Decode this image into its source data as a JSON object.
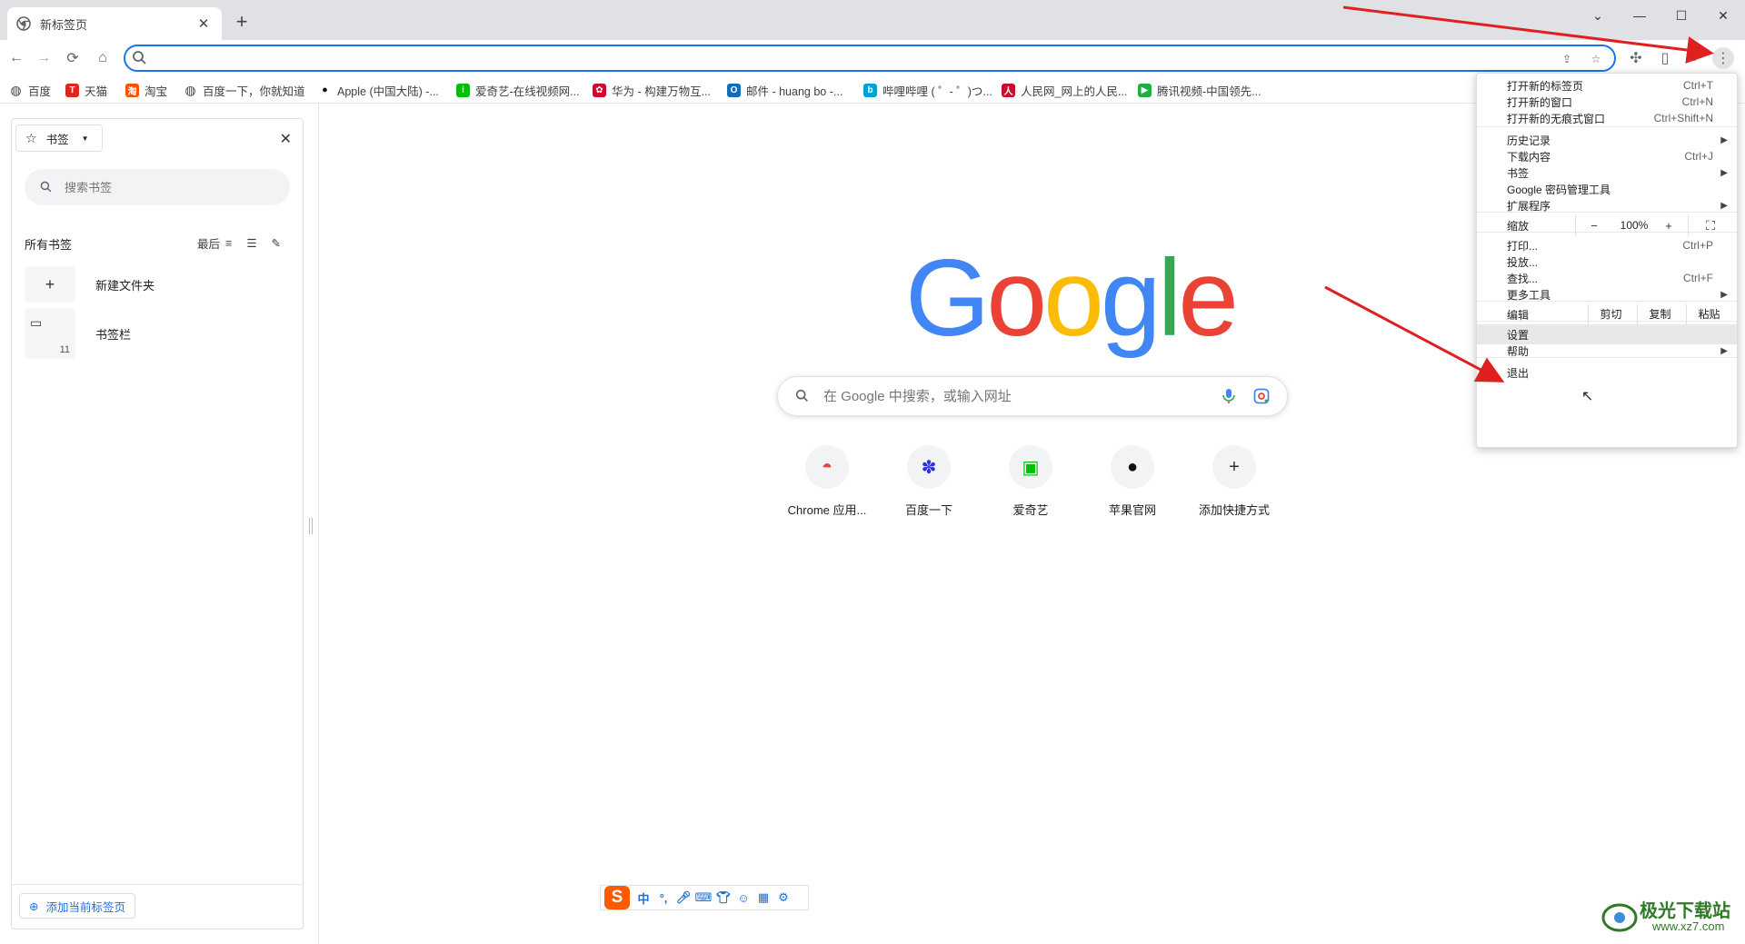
{
  "tab": {
    "title": "新标签页"
  },
  "omnibox": {
    "value": "",
    "placeholder": ""
  },
  "bookmarks_bar": [
    {
      "label": "百度",
      "icon": "globe-icon",
      "color": "#444444"
    },
    {
      "label": "天猫",
      "icon": "tmall-icon",
      "color": "#e1251b",
      "glyph": "T"
    },
    {
      "label": "淘宝",
      "icon": "taobao-icon",
      "color": "#ff5000",
      "glyph": "淘"
    },
    {
      "label": "百度一下，你就知道",
      "icon": "globe-icon",
      "color": "#444444"
    },
    {
      "label": "Apple (中国大陆) -...",
      "icon": "apple-icon",
      "color": "#111111"
    },
    {
      "label": "爱奇艺-在线视频网...",
      "icon": "iqiyi-icon",
      "color": "#00be06",
      "glyph": "i"
    },
    {
      "label": "华为 - 构建万物互...",
      "icon": "huawei-icon",
      "color": "#cf0a2c",
      "glyph": "✿"
    },
    {
      "label": "邮件 - huang bo -...",
      "icon": "outlook-icon",
      "color": "#0f6cbd",
      "glyph": "O"
    },
    {
      "label": "哔哩哔哩 ( ゜- ゜)つ...",
      "icon": "bilibili-icon",
      "color": "#00a1d6",
      "glyph": "b"
    },
    {
      "label": "人民网_网上的人民...",
      "icon": "people-icon",
      "color": "#c8102e",
      "glyph": "人"
    },
    {
      "label": "腾讯视频-中国领先...",
      "icon": "tencent-video-icon",
      "color": "#1fae44",
      "glyph": "▶"
    }
  ],
  "side_panel": {
    "dropdown_label": "书签",
    "search_placeholder": "搜索书签",
    "all_label": "所有书签",
    "sort_label": "最后",
    "items": [
      {
        "label": "新建文件夹",
        "icon": "plus-icon"
      },
      {
        "label": "书签栏",
        "icon": "folder-icon",
        "count": "11"
      }
    ],
    "add_button": "添加当前标签页"
  },
  "ntp": {
    "logo": [
      "G",
      "o",
      "o",
      "g",
      "l",
      "e"
    ],
    "logo_colors": [
      "#4285F4",
      "#EA4335",
      "#FBBC05",
      "#4285F4",
      "#34A853",
      "#EA4335"
    ],
    "search_placeholder": "在 Google 中搜索，或输入网址",
    "shortcuts": [
      {
        "label": "Chrome 应用...",
        "icon": "chrome-web-store-icon"
      },
      {
        "label": "百度一下",
        "icon": "baidu-paw-icon"
      },
      {
        "label": "爱奇艺",
        "icon": "iqiyi-icon"
      },
      {
        "label": "苹果官网",
        "icon": "apple-icon"
      },
      {
        "label": "添加快捷方式",
        "icon": "plus-icon"
      }
    ]
  },
  "menu": {
    "items": [
      {
        "label": "打开新的标签页",
        "shortcut": "Ctrl+T"
      },
      {
        "label": "打开新的窗口",
        "shortcut": "Ctrl+N"
      },
      {
        "label": "打开新的无痕式窗口",
        "shortcut": "Ctrl+Shift+N"
      },
      {
        "label": "历史记录",
        "shortcut": "",
        "submenu": true
      },
      {
        "label": "下载内容",
        "shortcut": "Ctrl+J"
      },
      {
        "label": "书签",
        "shortcut": "",
        "submenu": true
      },
      {
        "label": "Google 密码管理工具",
        "shortcut": ""
      },
      {
        "label": "扩展程序",
        "shortcut": "",
        "submenu": true
      },
      {
        "label": "打印...",
        "shortcut": "Ctrl+P"
      },
      {
        "label": "投放...",
        "shortcut": ""
      },
      {
        "label": "查找...",
        "shortcut": "Ctrl+F"
      },
      {
        "label": "更多工具",
        "shortcut": "",
        "submenu": true
      },
      {
        "label": "设置",
        "shortcut": ""
      },
      {
        "label": "帮助",
        "shortcut": "",
        "submenu": true
      },
      {
        "label": "退出",
        "shortcut": ""
      }
    ],
    "zoom": {
      "label": "缩放",
      "minus": "−",
      "value": "100%",
      "plus": "+"
    },
    "edit": {
      "label": "编辑",
      "cut": "剪切",
      "copy": "复制",
      "paste": "粘贴"
    },
    "highlighted": "设置"
  },
  "ime": {
    "logo": "S",
    "mode": "中",
    "punct": "°,"
  },
  "watermark": {
    "title": "极光下载站",
    "url": "www.xz7.com"
  },
  "colors": {
    "accent": "#1a73e8",
    "arrow": "#e02020"
  }
}
